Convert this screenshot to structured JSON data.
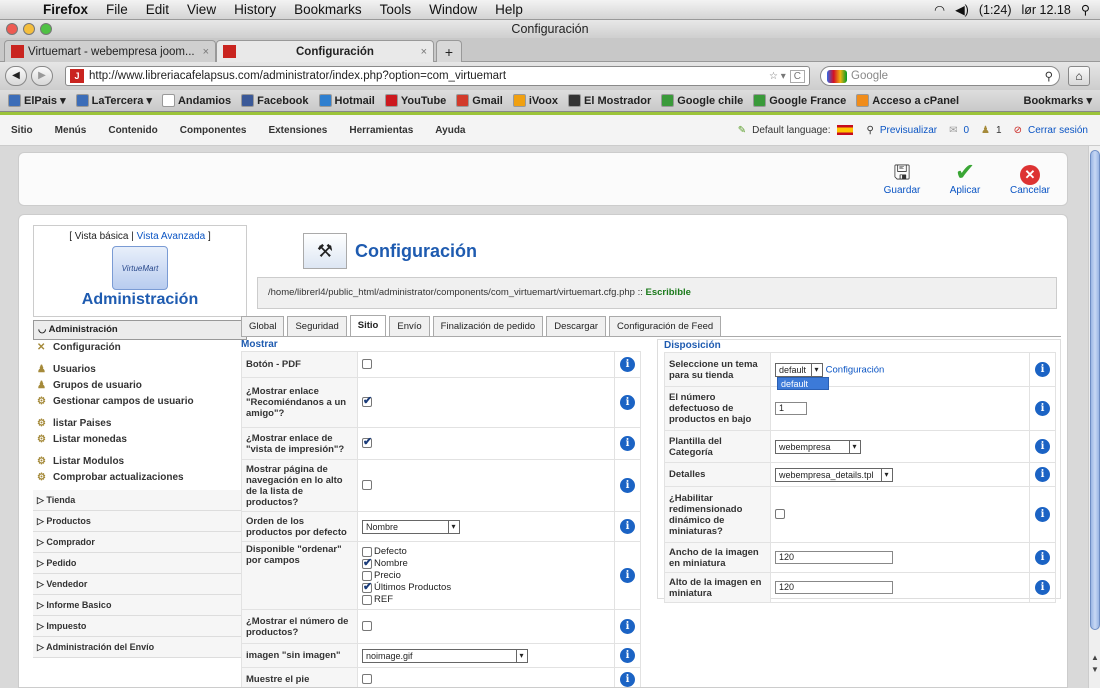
{
  "menubar": {
    "app": "Firefox",
    "items": [
      "File",
      "Edit",
      "View",
      "History",
      "Bookmarks",
      "Tools",
      "Window",
      "Help"
    ],
    "battery": "(1:24)",
    "clock": "lør 12.18"
  },
  "window": {
    "title": "Configuración"
  },
  "tabs": [
    {
      "label": "Virtuemart - webempresa joom...",
      "close": "×"
    },
    {
      "label": "Configuración",
      "close": "×"
    }
  ],
  "nav": {
    "url": "http://www.libreriacafelapsus.com/administrator/index.php?option=com_virtuemart",
    "search_placeholder": "Google",
    "back": "◀",
    "forward": "▶",
    "reload": "C",
    "home": "⌂"
  },
  "bookmarks": [
    {
      "label": "ElPais ▾",
      "color": "#3c6db8"
    },
    {
      "label": "LaTercera ▾",
      "color": "#3c6db8"
    },
    {
      "label": "Andamios",
      "color": "#ffffff"
    },
    {
      "label": "Facebook",
      "color": "#3b5998"
    },
    {
      "label": "Hotmail",
      "color": "#2f7fcf"
    },
    {
      "label": "YouTube",
      "color": "#cc181e"
    },
    {
      "label": "Gmail",
      "color": "#d23a2a"
    },
    {
      "label": "iVoox",
      "color": "#f0a010"
    },
    {
      "label": "El Mostrador",
      "color": "#333333"
    },
    {
      "label": "Google chile",
      "color": "#3a9a3a"
    },
    {
      "label": "Google France",
      "color": "#3a9a3a"
    },
    {
      "label": "Acceso a cPanel",
      "color": "#f08c1a"
    }
  ],
  "bookmarks_right": "Bookmarks ▾",
  "joomla_menu": {
    "items": [
      "Sitio",
      "Menús",
      "Contenido",
      "Componentes",
      "Extensiones",
      "Herramientas",
      "Ayuda"
    ],
    "default_language": "Default language:",
    "preview": "Previsualizar",
    "msg_count": "0",
    "user_count": "1",
    "logout": "Cerrar sesión"
  },
  "toolbar": {
    "save": "Guardar",
    "apply": "Aplicar",
    "cancel": "Cancelar"
  },
  "sidebar": {
    "view_basic": "[ Vista básica |",
    "view_advanced": "Vista Avanzada",
    "view_end": "]",
    "logo_text": "VirtueMart",
    "admin_title": "Administración",
    "header": "Administración",
    "items": [
      {
        "label": "Configuración",
        "icon": "wrench-icon"
      },
      {
        "label": "Usuarios",
        "icon": "users-icon"
      },
      {
        "label": "Grupos de usuario",
        "icon": "users-icon"
      },
      {
        "label": "Gestionar campos de usuario",
        "icon": "gear-icon"
      },
      {
        "label": "listar Paises",
        "icon": "gear-icon"
      },
      {
        "label": "Listar monedas",
        "icon": "gear-icon"
      },
      {
        "label": "Listar Modulos",
        "icon": "gear-icon"
      },
      {
        "label": "Comprobar actualizaciones",
        "icon": "gear-icon"
      }
    ],
    "categories": [
      "Tienda",
      "Productos",
      "Comprador",
      "Pedido",
      "Vendedor",
      "Informe Basico",
      "Impuesto",
      "Administración del Envío"
    ]
  },
  "page": {
    "title": "Configuración",
    "path": "/home/librerl4/public_html/administrator/components/com_virtuemart/virtuemart.cfg.php ::",
    "path_status": "Escribible"
  },
  "config_tabs": [
    "Global",
    "Seguridad",
    "Sitio",
    "Envío",
    "Finalización de pedido",
    "Descargar",
    "Configuración de Feed"
  ],
  "mostrar": {
    "legend": "Mostrar",
    "pdf": "Botón - PDF",
    "recommend": "¿Mostrar enlace \"Recomiéndanos a un amigo\"?",
    "print": "¿Mostrar enlace de \"vista de impresión\"?",
    "navpage": "Mostrar página de navegación en lo alto de la lista de productos?",
    "order": "Orden de los productos por defecto",
    "order_value": "Nombre",
    "sortfields": "Disponible \"ordenar\" por campos",
    "sort_options": [
      {
        "label": "Defecto",
        "checked": false
      },
      {
        "label": "Nombre",
        "checked": true
      },
      {
        "label": "Precio",
        "checked": false
      },
      {
        "label": "Últimos Productos",
        "checked": true
      },
      {
        "label": "REF",
        "checked": false
      }
    ],
    "count": "¿Mostrar el número de productos?",
    "noimage": "imagen \"sin imagen\"",
    "noimage_value": "noimage.gif",
    "footer": "Muestre el pie"
  },
  "disposicion": {
    "legend": "Disposición",
    "theme": "Seleccione un tema para su tienda",
    "theme_value": "default",
    "theme_link": "Configuración",
    "theme_option": "default",
    "defcount": "El número defectuoso de productos en bajo",
    "defcount_value": "1",
    "cattemplate": "Plantilla del Categoría",
    "cattemplate_value": "webempresa",
    "details": "Detalles",
    "details_value": "webempresa_details.tpl",
    "resize": "¿Habilitar redimensionado dinámico de miniaturas?",
    "thumbw": "Ancho de la imagen en miniatura",
    "thumbw_value": "120",
    "thumbh": "Alto de la imagen en miniatura",
    "thumbh_value": "120"
  }
}
